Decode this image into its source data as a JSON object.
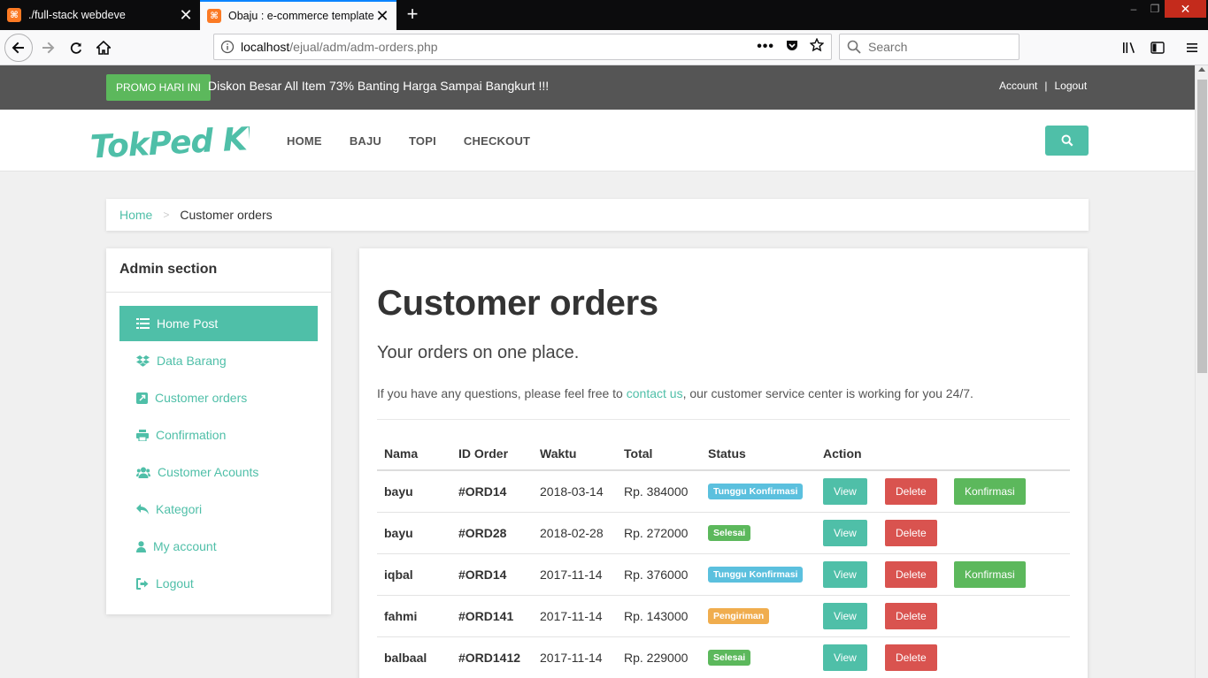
{
  "browser": {
    "tabs": [
      {
        "title": "./full-stack webdeve",
        "active": false
      },
      {
        "title": "Obaju : e-commerce template",
        "active": true
      }
    ],
    "url": {
      "host": "localhost",
      "path": "/ejual/adm/adm-orders.php"
    },
    "search_placeholder": "Search"
  },
  "topbar": {
    "promo_label": "PROMO HARI INI",
    "promo_text": "Diskon Besar All Item 73% Banting Harga Sampai Bangkurt !!!",
    "account": "Account",
    "separator": "|",
    "logout": "Logout"
  },
  "header": {
    "logo_text": "TokPed KW",
    "menu": [
      "HOME",
      "BAJU",
      "TOPI",
      "CHECKOUT"
    ]
  },
  "breadcrumb": {
    "home": "Home",
    "separator": ">",
    "current": "Customer orders"
  },
  "sidebar": {
    "title": "Admin section",
    "items": [
      {
        "label": "Home Post",
        "icon": "list-icon",
        "active": true
      },
      {
        "label": "Data Barang",
        "icon": "dropbox-icon",
        "active": false
      },
      {
        "label": "Customer orders",
        "icon": "external-link-icon",
        "active": false
      },
      {
        "label": "Confirmation",
        "icon": "print-icon",
        "active": false
      },
      {
        "label": "Customer Acounts",
        "icon": "users-icon",
        "active": false
      },
      {
        "label": "Kategori",
        "icon": "reply-icon",
        "active": false
      },
      {
        "label": "My account",
        "icon": "user-icon",
        "active": false
      },
      {
        "label": "Logout",
        "icon": "sign-out-icon",
        "active": false
      }
    ]
  },
  "main": {
    "title": "Customer orders",
    "lead": "Your orders on one place.",
    "info_before": "If you have any questions, please feel free to ",
    "info_link": "contact us",
    "info_after": ", our customer service center is working for you 24/7.",
    "table": {
      "headers": [
        "Nama",
        "ID Order",
        "Waktu",
        "Total",
        "Status",
        "Action"
      ],
      "rows": [
        {
          "nama": "bayu",
          "id": "#ORD14",
          "waktu": "2018-03-14",
          "total": "Rp. 384000",
          "status": "Tunggu Konfirmasi",
          "status_color": "#5bc0de",
          "konfirmasi": true
        },
        {
          "nama": "bayu",
          "id": "#ORD28",
          "waktu": "2018-02-28",
          "total": "Rp. 272000",
          "status": "Selesai",
          "status_color": "#5cb85c",
          "konfirmasi": false
        },
        {
          "nama": "iqbal",
          "id": "#ORD14",
          "waktu": "2017-11-14",
          "total": "Rp. 376000",
          "status": "Tunggu Konfirmasi",
          "status_color": "#5bc0de",
          "konfirmasi": true
        },
        {
          "nama": "fahmi",
          "id": "#ORD141",
          "waktu": "2017-11-14",
          "total": "Rp. 143000",
          "status": "Pengiriman",
          "status_color": "#f0ad4e",
          "konfirmasi": false
        },
        {
          "nama": "balbaal",
          "id": "#ORD1412",
          "waktu": "2017-11-14",
          "total": "Rp. 229000",
          "status": "Selesai",
          "status_color": "#5cb85c",
          "konfirmasi": false
        }
      ],
      "view_label": "View",
      "delete_label": "Delete",
      "konfirmasi_label": "Konfirmasi"
    }
  },
  "colors": {
    "accent": "#4fbfa8",
    "success": "#5cb85c",
    "danger": "#d9534f",
    "info": "#5bc0de",
    "warning": "#f0ad4e",
    "topbar": "#555555"
  }
}
